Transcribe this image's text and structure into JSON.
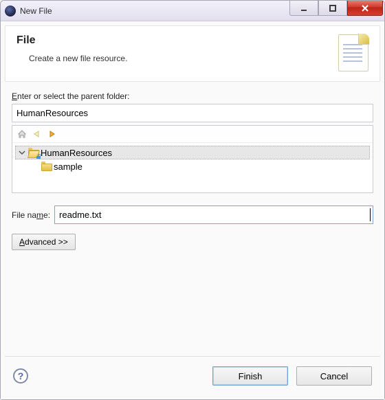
{
  "window": {
    "title": "New File"
  },
  "header": {
    "title": "File",
    "subtitle": "Create a new file resource."
  },
  "parent": {
    "label_pre": "",
    "label_mn": "E",
    "label_post": "nter or select the parent folder:",
    "value": "HumanResources"
  },
  "tree": {
    "root": {
      "label": "HumanResources"
    },
    "child": {
      "label": "sample"
    }
  },
  "filename": {
    "label_pre": "File na",
    "label_mn": "m",
    "label_post": "e:",
    "value": "readme.txt"
  },
  "advanced": {
    "label_mn": "A",
    "label_post": "dvanced >>"
  },
  "footer": {
    "finish": "Finish",
    "cancel": "Cancel",
    "help": "?"
  }
}
